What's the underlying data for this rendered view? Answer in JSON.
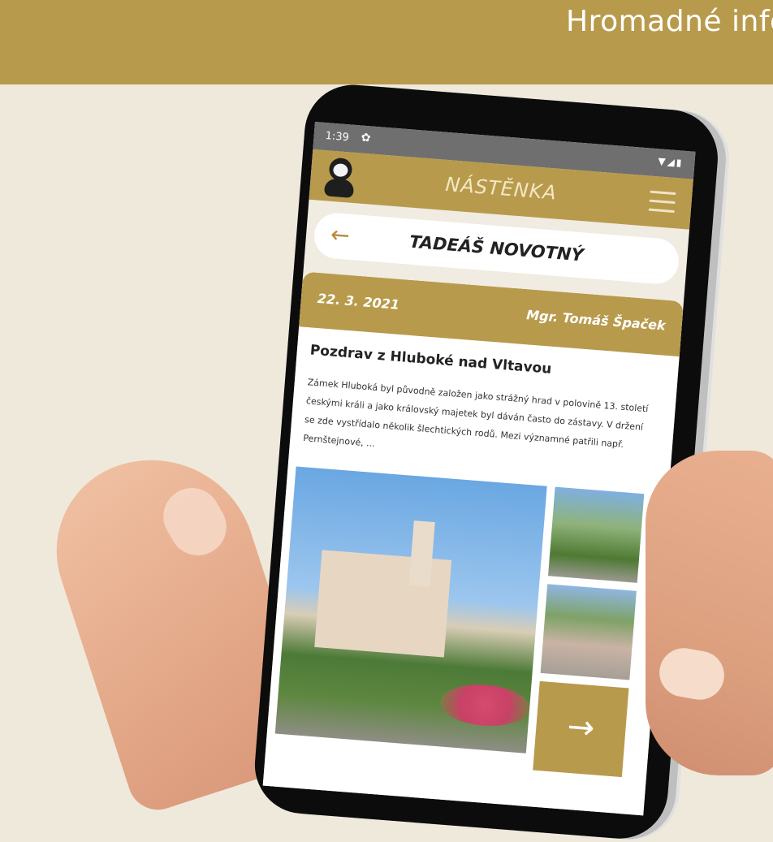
{
  "banner": {
    "title": "Hromadné info"
  },
  "status": {
    "time": "1:39"
  },
  "appbar": {
    "title": "NÁSTĚNKA"
  },
  "header": {
    "back_arrow": "←",
    "person_name": "TADEÁŠ NOVOTNÝ"
  },
  "post": {
    "date": "22. 3. 2021",
    "author": "Mgr. Tomáš Špaček",
    "title": "Pozdrav z Hluboké nad Vltavou",
    "text": "Zámek Hluboká byl původně založen jako strážný hrad v polovině 13. století českými králi a jako královský majetek byl dáván často do zástavy. V držení se zde vystřídalo několik šlechtických rodů. Mezi významné patřili např. Pernštejnové, ...",
    "more_arrow": "→"
  },
  "colors": {
    "accent": "#b89a4c",
    "background": "#efe9dc"
  },
  "icons": [
    "gear-icon",
    "wifi-icon",
    "signal-icon",
    "battery-icon",
    "menu-icon",
    "back-arrow-icon",
    "next-arrow-icon"
  ]
}
